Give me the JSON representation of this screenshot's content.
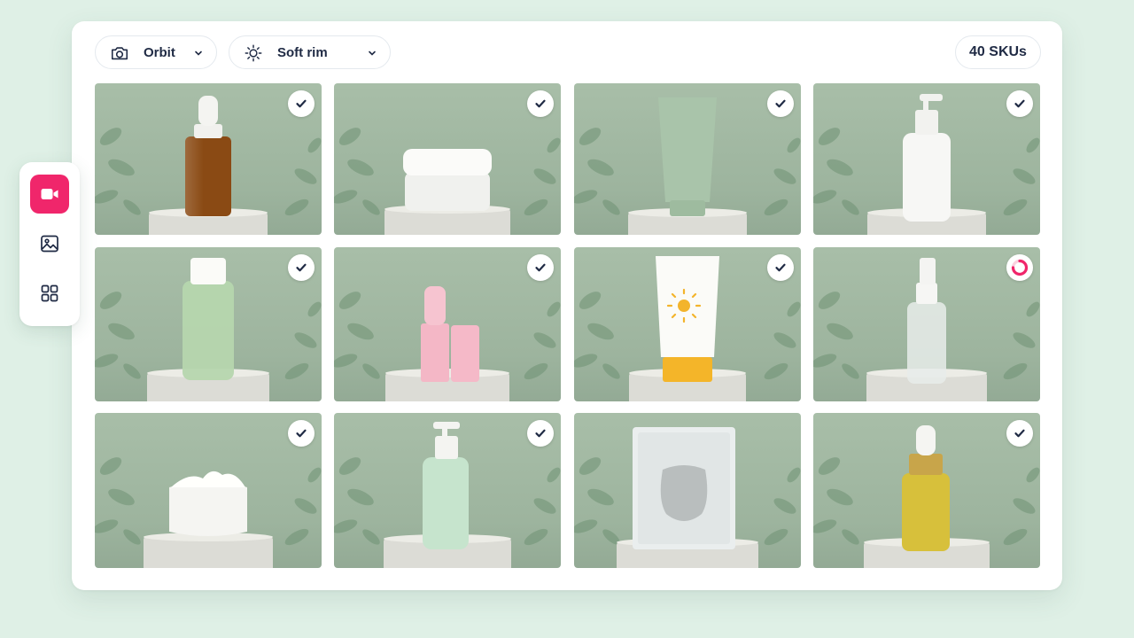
{
  "toolbar": {
    "camera_mode": {
      "label": "Orbit",
      "icon": "camera-icon"
    },
    "lighting": {
      "label": "Soft rim",
      "icon": "sun-icon"
    },
    "sku_count": "40 SKUs"
  },
  "side_rail": {
    "items": [
      {
        "icon": "video-camera-icon",
        "active": true
      },
      {
        "icon": "image-icon",
        "active": false
      },
      {
        "icon": "grid-icon",
        "active": false
      }
    ]
  },
  "products": [
    {
      "item": "amber dropper bottle",
      "status": "done"
    },
    {
      "item": "cream jar",
      "status": "done"
    },
    {
      "item": "sage tube",
      "status": "done"
    },
    {
      "item": "white pump bottle",
      "status": "done"
    },
    {
      "item": "green toner bottle",
      "status": "done"
    },
    {
      "item": "pink lip balms",
      "status": "done"
    },
    {
      "item": "sunscreen tube",
      "status": "done"
    },
    {
      "item": "clear spray bottle",
      "status": "processing"
    },
    {
      "item": "open cream jar",
      "status": "done"
    },
    {
      "item": "mint pump bottle",
      "status": "done"
    },
    {
      "item": "sheet mask pouch",
      "status": "none"
    },
    {
      "item": "gold serum dropper",
      "status": "done"
    }
  ],
  "colors": {
    "accent": "#f0266b",
    "background": "#dff0e6",
    "tile_backdrop": "#a3b9a4",
    "check": "#1f2a44"
  }
}
